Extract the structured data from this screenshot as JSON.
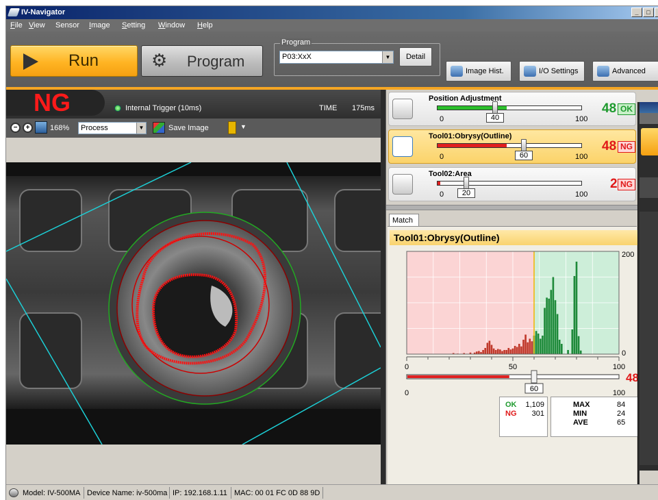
{
  "window": {
    "title": "IV-Navigator",
    "controls": [
      "_",
      "□",
      "×"
    ]
  },
  "menu": [
    {
      "label": "File",
      "key": "F",
      "rest": "ile"
    },
    {
      "label": "View",
      "key": "V",
      "rest": "iew"
    },
    {
      "label": "Sensor",
      "key": "",
      "rest": "Sensor"
    },
    {
      "label": "Image",
      "key": "I",
      "rest": "mage"
    },
    {
      "label": "Setting",
      "key": "S",
      "rest": "etting"
    },
    {
      "label": "Window",
      "key": "W",
      "rest": "indow"
    },
    {
      "label": "Help",
      "key": "H",
      "rest": "elp"
    }
  ],
  "toolbar": {
    "run_label": "Run",
    "program_label": "Program",
    "program_group_label": "Program",
    "program_value": "P03:XxX",
    "detail_label": "Detail",
    "image_hist_label": "Image Hist.",
    "io_settings_label": "I/O Settings",
    "advanced_label": "Advanced"
  },
  "result": {
    "status": "NG",
    "trigger_text": "Internal Trigger (10ms)",
    "time_label": "TIME",
    "time_value": "175ms",
    "status_color": "#ff1a1a"
  },
  "image_toolbar": {
    "zoom": "168%",
    "display_mode": "Process",
    "save_image_label": "Save Image"
  },
  "tools": [
    {
      "name": "Position Adjustment",
      "score": "48",
      "judgement": "OK",
      "min": "0",
      "max": "100",
      "threshold": "40",
      "score_value": 48,
      "threshold_value": 40,
      "fill_color": "#2bbf2b",
      "active": false
    },
    {
      "name": "Tool01:Obrysy(Outline)",
      "score": "48",
      "judgement": "NG",
      "min": "0",
      "max": "100",
      "threshold": "60",
      "score_value": 48,
      "threshold_value": 60,
      "fill_color": "#e02020",
      "active": true
    },
    {
      "name": "Tool02:Area",
      "score": "2",
      "judgement": "NG",
      "min": "0",
      "max": "100",
      "threshold": "20",
      "score_value": 2,
      "threshold_value": 20,
      "fill_color": "#e02020",
      "active": false
    }
  ],
  "match": {
    "tab_label": "Match",
    "title": "Tool01:Obrysy(Outline)",
    "score_display": "48",
    "slider_threshold": "60",
    "slider_min": "0",
    "slider_max": "100"
  },
  "chart_data": {
    "type": "bar",
    "title": "",
    "xlabel": "",
    "ylabel": "",
    "xlim": [
      0,
      100
    ],
    "ylim": [
      0,
      200
    ],
    "x_ticks": [
      "0",
      "50",
      "100"
    ],
    "y_ticks": [
      "200",
      "0"
    ],
    "threshold": 60,
    "ng_color": "#c0392b",
    "ok_color": "#1e8a3a",
    "x": [
      22,
      24,
      27,
      30,
      32,
      33,
      34,
      35,
      36,
      37,
      38,
      39,
      40,
      41,
      42,
      43,
      44,
      45,
      46,
      47,
      48,
      49,
      50,
      51,
      52,
      53,
      54,
      55,
      56,
      57,
      58,
      59,
      60,
      61,
      62,
      63,
      64,
      65,
      66,
      67,
      68,
      69,
      70,
      71,
      72,
      73,
      76,
      78,
      79,
      80,
      81,
      82
    ],
    "values": [
      2,
      1,
      2,
      3,
      3,
      5,
      6,
      4,
      8,
      12,
      22,
      26,
      18,
      11,
      8,
      10,
      9,
      6,
      8,
      8,
      12,
      9,
      11,
      16,
      14,
      20,
      15,
      28,
      38,
      23,
      30,
      25,
      36,
      45,
      40,
      30,
      36,
      90,
      110,
      108,
      125,
      150,
      105,
      78,
      28,
      20,
      8,
      48,
      152,
      180,
      35,
      7
    ]
  },
  "stats": {
    "ok_label": "OK",
    "ok_value": "1,109",
    "ng_label": "NG",
    "ng_value": "301",
    "max_label": "MAX",
    "max_value": "84",
    "min_label": "MIN",
    "min_value": "24",
    "ave_label": "AVE",
    "ave_value": "65"
  },
  "statusbar": {
    "model": "Model: IV-500MA",
    "device": "Device Name: iv-500ma",
    "ip": "IP: 192.168.1.11",
    "mac": "MAC: 00 01 FC 0D 88 9D"
  }
}
